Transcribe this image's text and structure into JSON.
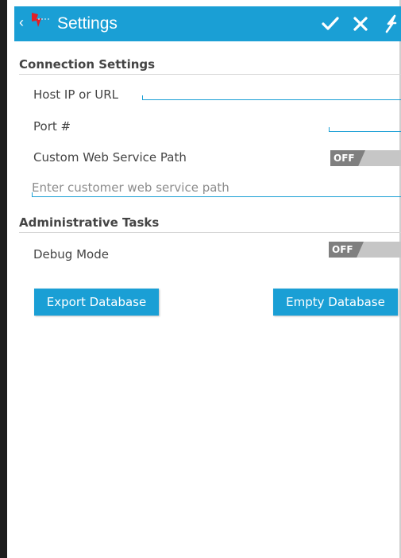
{
  "header": {
    "title": "Settings",
    "back_glyph": "‹",
    "icons": [
      "back-icon",
      "app-logo-icon",
      "checkmark-icon",
      "close-icon",
      "bolt-icon"
    ],
    "accent": "#1a9fd5"
  },
  "connection": {
    "section_title": "Connection Settings",
    "host_label": "Host IP or URL",
    "host_value": "",
    "port_label": "Port #",
    "port_value": "",
    "custom_path_label": "Custom Web Service Path",
    "custom_path_toggle": "OFF",
    "custom_path_placeholder": "Enter customer web service path"
  },
  "admin": {
    "section_title": "Administrative Tasks",
    "debug_label": "Debug Mode",
    "debug_toggle": "OFF",
    "export_button": "Export Database",
    "empty_button": "Empty Database"
  }
}
